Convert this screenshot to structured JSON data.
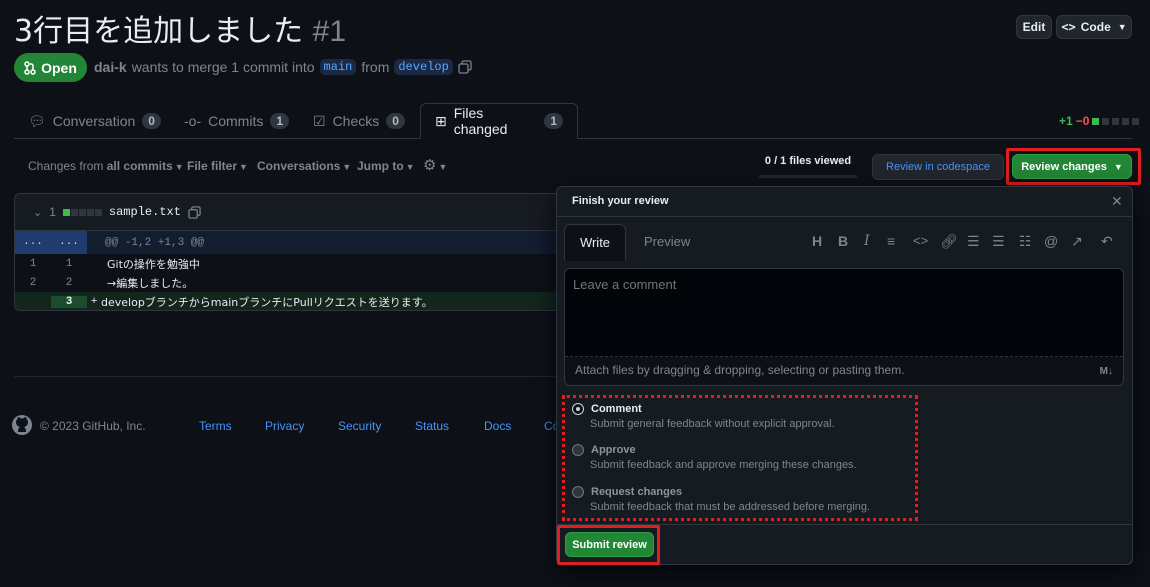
{
  "pr": {
    "title": "3行目を追加しました",
    "number": "#1",
    "edit_label": "Edit",
    "code_label": "Code",
    "state": "Open",
    "author": "dai-k",
    "meta_text": "wants to merge 1 commit into",
    "base_branch": "main",
    "from_text": "from",
    "head_branch": "develop"
  },
  "tabs": [
    {
      "label": "Conversation",
      "count": "0"
    },
    {
      "label": "Commits",
      "count": "1"
    },
    {
      "label": "Checks",
      "count": "0"
    },
    {
      "label": "Files changed",
      "count": "1"
    }
  ],
  "diffstat": {
    "added": "+1",
    "removed": "−0"
  },
  "toolbar": {
    "changes_from": "Changes from",
    "all_commits": "all commits",
    "file_filter": "File filter",
    "conversations": "Conversations",
    "jump_to": "Jump to",
    "files_viewed": "0 / 1 files viewed",
    "review_codespace": "Review in codespace",
    "review_changes": "Review changes"
  },
  "file": {
    "changes": "1",
    "name": "sample.txt",
    "hunk_left": "...",
    "hunk_right": "...",
    "hunk": "@@ -1,2 +1,3 @@",
    "lines": [
      {
        "old": "1",
        "new": "1",
        "sign": "",
        "text": "Gitの操作を勉強中"
      },
      {
        "old": "2",
        "new": "2",
        "sign": "",
        "text": "→編集しました。"
      },
      {
        "old": "",
        "new": "3",
        "sign": "+",
        "text": "developブランチからmainブランチにPullリクエストを送ります。"
      }
    ]
  },
  "footer": {
    "copyright": "© 2023 GitHub, Inc.",
    "links": [
      "Terms",
      "Privacy",
      "Security",
      "Status",
      "Docs",
      "Co"
    ]
  },
  "review": {
    "title": "Finish your review",
    "write_tab": "Write",
    "preview_tab": "Preview",
    "placeholder": "Leave a comment",
    "attach_text": "Attach files by dragging & dropping, selecting or pasting them.",
    "options": [
      {
        "label": "Comment",
        "desc": "Submit general feedback without explicit approval.",
        "selected": true
      },
      {
        "label": "Approve",
        "desc": "Submit feedback and approve merging these changes.",
        "selected": false
      },
      {
        "label": "Request changes",
        "desc": "Submit feedback that must be addressed before merging.",
        "selected": false
      }
    ],
    "submit": "Submit review"
  },
  "colors": {
    "accent_green": "#238636",
    "link_blue": "#4493f8",
    "highlight_red": "#e11d1d",
    "bg": "#0d1117"
  }
}
